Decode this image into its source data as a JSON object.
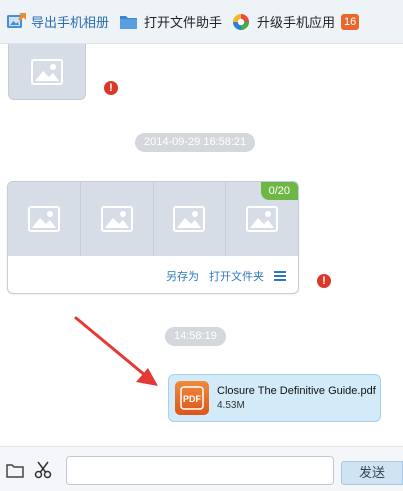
{
  "toolbar": {
    "export_album": "导出手机相册",
    "open_file_helper": "打开文件助手",
    "upgrade_apps": "升级手机应用",
    "upgrade_badge": "16"
  },
  "chat": {
    "timestamp_1": "2014-09-29 16:58:21",
    "timestamp_2": "14:58:19",
    "error_glyph": "!",
    "gallery": {
      "count": "0/20",
      "save_as": "另存为",
      "open_folder": "打开文件夹"
    },
    "file": {
      "name": "Closure The Definitive Guide.pdf",
      "size": "4.53M",
      "icon_text": "PDF"
    }
  },
  "input_bar": {
    "send_label": "发送",
    "message_value": ""
  },
  "colors": {
    "accent_blue": "#2e78c2",
    "error_red": "#d9382b",
    "badge_orange": "#e8672d",
    "count_green": "#6fb745",
    "annotation_arrow": "#e53935"
  }
}
